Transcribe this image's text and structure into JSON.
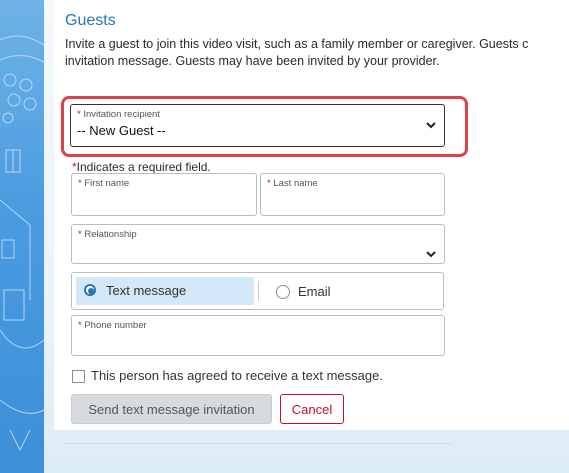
{
  "section_title": "Guests",
  "intro_line1": "Invite a guest to join this video visit, such as a family member or caregiver. Guests c",
  "intro_line2": "invitation message. Guests may have been invited by your provider.",
  "required_star": "*",
  "invitation_recipient": {
    "label": "Invitation recipient",
    "value": "-- New Guest --"
  },
  "required_note": "Indicates a required field.",
  "first_name": {
    "label": "First name",
    "value": ""
  },
  "last_name": {
    "label": "Last name",
    "value": ""
  },
  "relationship": {
    "label": "Relationship",
    "value": ""
  },
  "contact_method": {
    "options": [
      "Text message",
      "Email"
    ],
    "selected": "Text message"
  },
  "phone_number": {
    "label": "Phone number",
    "value": ""
  },
  "consent_label": "This person has agreed to receive a text message.",
  "consent_checked": false,
  "send_button": "Send text message invitation",
  "cancel_button": "Cancel",
  "colors": {
    "accent": "#2a73b8",
    "required": "#c8102e",
    "highlight": "#e0404a"
  }
}
